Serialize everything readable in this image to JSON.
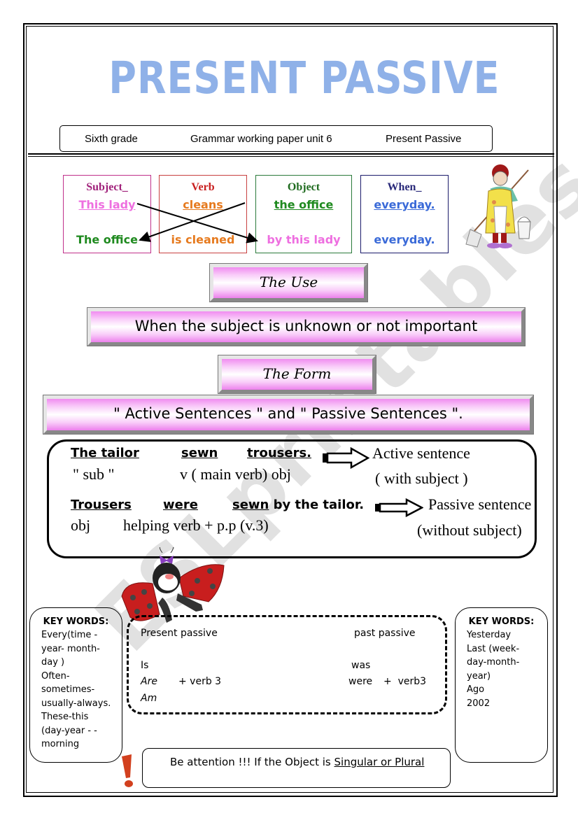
{
  "title": "PRESENT PASSIVE",
  "header": {
    "grade": "Sixth grade",
    "paper": "Grammar working paper unit 6",
    "topic": "Present Passive"
  },
  "grammar_boxes": [
    {
      "heading": "Subject_",
      "active": "This lady",
      "passive": "The office",
      "heading_color": "#a0207a",
      "active_color": "#ee6fe0",
      "passive_color": "#1f8a1f",
      "border_color": "#c0308a"
    },
    {
      "heading": "Verb",
      "active": "cleans",
      "passive": "is cleaned",
      "heading_color": "#c81e1e",
      "active_color": "#e67a1e",
      "passive_color": "#e67a1e",
      "border_color": "#c84040"
    },
    {
      "heading": "Object",
      "active": "the office",
      "passive": "by this lady",
      "heading_color": "#1e6a1e",
      "active_color": "#1f8a1f",
      "passive_color": "#ee6fe0",
      "border_color": "#2a7a3a"
    },
    {
      "heading": "When_",
      "active": "everyday.",
      "passive": "everyday.",
      "heading_color": "#2a2a7a",
      "active_color": "#3a6ad8",
      "passive_color": "#3a6ad8",
      "border_color": "#1a1a6a"
    }
  ],
  "sections": {
    "use_label": "The Use",
    "use_text": "When the subject is unknown or not important",
    "form_label": "The Form",
    "form_text": "\" Active Sentences \" and \" Passive Sentences \"."
  },
  "examples": {
    "active": {
      "words": [
        "The tailor",
        "sewn",
        "trousers."
      ],
      "gloss_sub": "\" sub \"",
      "gloss_rest": "v ( main verb) obj",
      "label": "Active sentence",
      "note": "( with subject )"
    },
    "passive": {
      "words": [
        "Trousers",
        "were",
        "sewn"
      ],
      "tail": " by the tailor.",
      "gloss_obj": "obj",
      "gloss_rest": "helping verb + p.p (v.3)",
      "label": "Passive sentence",
      "note": "(without subject)"
    }
  },
  "key_words_present": {
    "title": "KEY WORDS:",
    "lines": [
      "Every(time -",
      "year- month-",
      "day )",
      "Often-",
      "sometimes-",
      "usually-always.",
      "These-this",
      "(day-year - -",
      "morning"
    ]
  },
  "key_words_past": {
    "title": "KEY WORDS:",
    "lines": [
      "Yesterday",
      "Last (week-",
      "day-month-",
      "year)",
      "Ago",
      "2002"
    ]
  },
  "forms_table": {
    "present_heading": "Present passive",
    "past_heading": "past passive",
    "present_aux": [
      "Is",
      "Are",
      "Am"
    ],
    "present_formula": "+ verb 3",
    "past_aux": [
      "was",
      "were"
    ],
    "past_formula": "+  verb3"
  },
  "attention": {
    "prefix": "Be attention !!! If the Object is ",
    "emphasis": "Singular or Plural"
  },
  "watermark": "ESLprintables.com",
  "colors": {
    "title": "#8fb1e8",
    "bar_pink": "#f08cf0",
    "exclamation": "#d2401e"
  }
}
